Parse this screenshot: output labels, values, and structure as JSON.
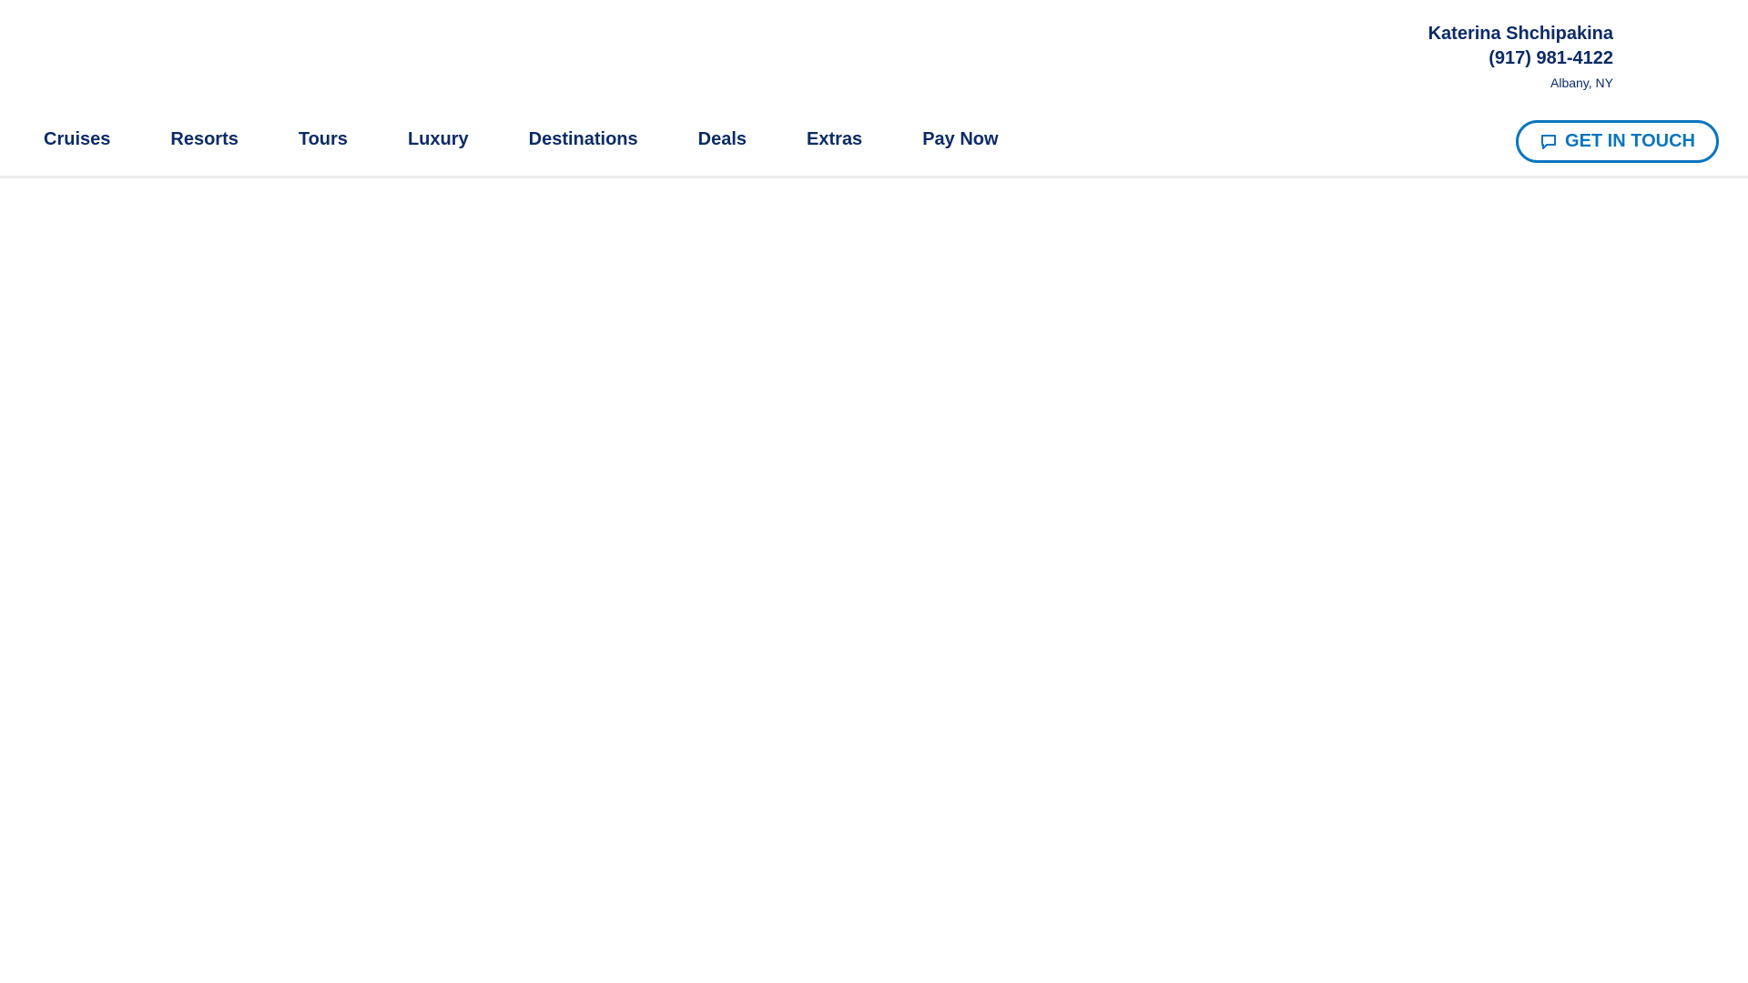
{
  "agent": {
    "name": "Katerina Shchipakina",
    "phone": "(917) 981-4122",
    "location": "Albany, NY"
  },
  "nav": {
    "items": [
      {
        "label": "Cruises"
      },
      {
        "label": "Resorts"
      },
      {
        "label": "Tours"
      },
      {
        "label": "Luxury"
      },
      {
        "label": "Destinations"
      },
      {
        "label": "Deals"
      },
      {
        "label": "Extras"
      },
      {
        "label": "Pay Now"
      }
    ]
  },
  "cta": {
    "label": "GET IN TOUCH",
    "icon": "chat-bubble-icon"
  },
  "colors": {
    "nav_text": "#0c2b66",
    "accent": "#0a75bf",
    "divider": "#ebebeb"
  }
}
